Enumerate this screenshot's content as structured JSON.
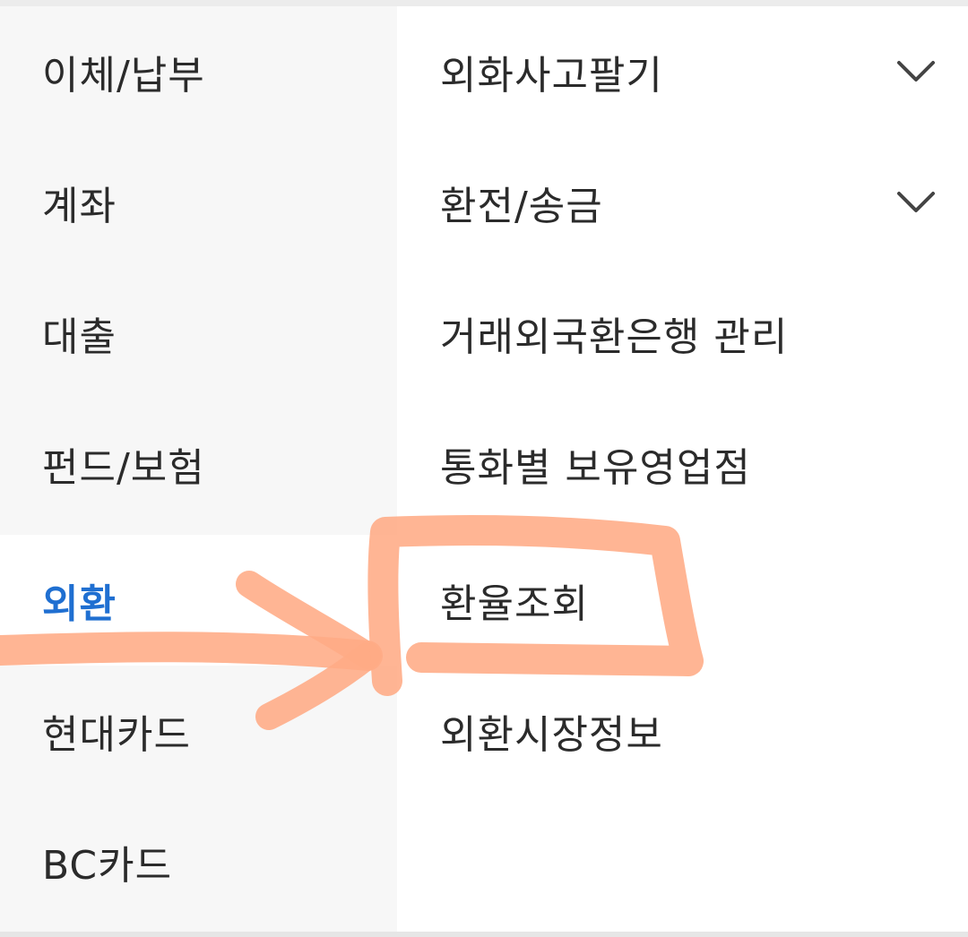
{
  "left_menu": {
    "items": [
      {
        "label": "이체/납부"
      },
      {
        "label": "계좌"
      },
      {
        "label": "대출"
      },
      {
        "label": "펀드/보험"
      },
      {
        "label": "외환"
      },
      {
        "label": "현대카드"
      },
      {
        "label": "BC카드"
      }
    ],
    "active_index": 4
  },
  "right_menu": {
    "items": [
      {
        "label": "외화사고팔기",
        "expandable": true,
        "icon": "chevron-down-icon"
      },
      {
        "label": "환전/송금",
        "expandable": true,
        "icon": "chevron-down-icon"
      },
      {
        "label": "거래외국환은행 관리",
        "expandable": false
      },
      {
        "label": "통화별 보유영업점",
        "expandable": false
      },
      {
        "label": "환율조회",
        "expandable": false
      },
      {
        "label": "외환시장정보",
        "expandable": false
      }
    ]
  },
  "colors": {
    "active": "#1f6fd1",
    "text": "#2b2b2b",
    "left_bg": "#f7f7f7",
    "annotation": "#ffab85"
  },
  "annotation": {
    "type": "hand-drawn highlight",
    "shapes": [
      "arrow-right",
      "rectangle"
    ]
  }
}
